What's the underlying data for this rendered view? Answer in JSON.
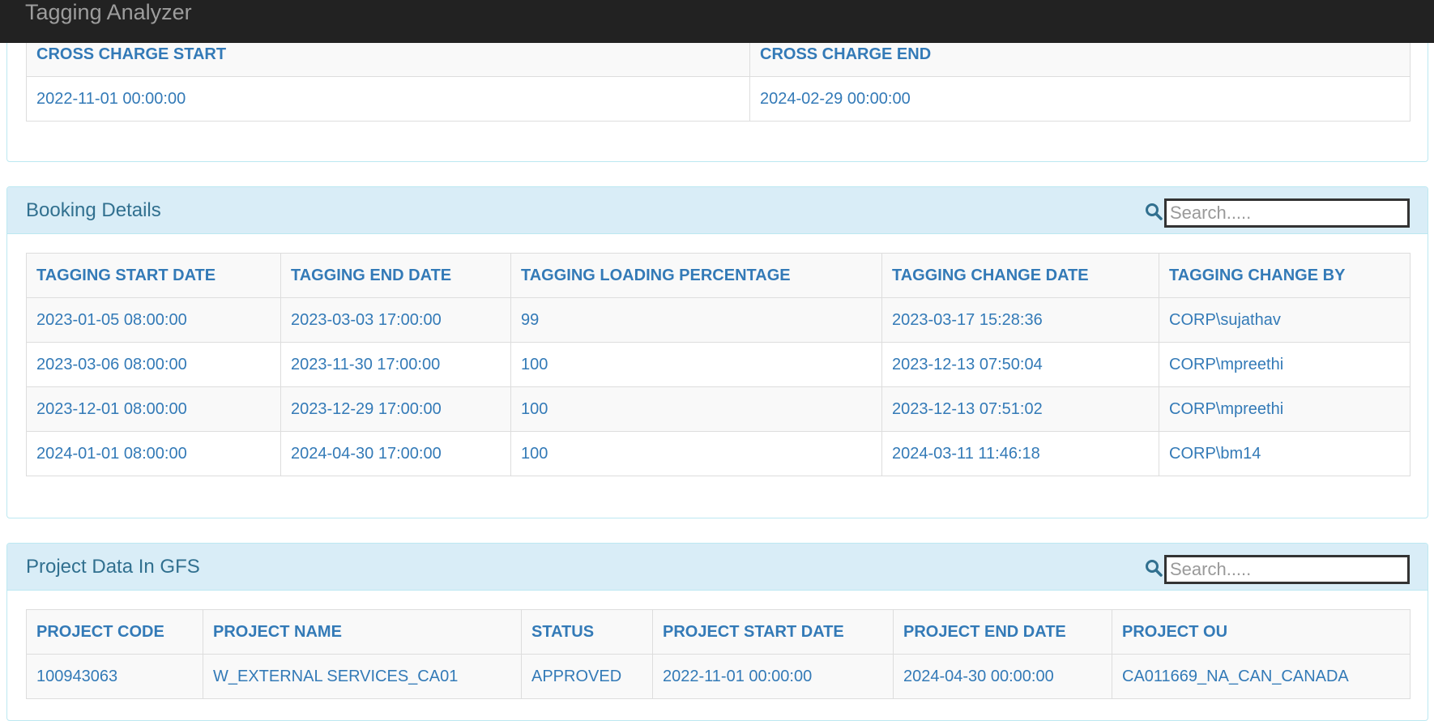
{
  "app": {
    "title": "Tagging Analyzer"
  },
  "cross_charge": {
    "headers": [
      "CROSS CHARGE START",
      "CROSS CHARGE END"
    ],
    "row": [
      "2022-11-01 00:00:00",
      "2024-02-29 00:00:00"
    ]
  },
  "booking": {
    "title": "Booking Details",
    "search_placeholder": "Search.....",
    "headers": [
      "TAGGING START DATE",
      "TAGGING END DATE",
      "TAGGING LOADING PERCENTAGE",
      "TAGGING CHANGE DATE",
      "TAGGING CHANGE BY"
    ],
    "rows": [
      [
        "2023-01-05 08:00:00",
        "2023-03-03 17:00:00",
        "99",
        "2023-03-17 15:28:36",
        "CORP\\sujathav"
      ],
      [
        "2023-03-06 08:00:00",
        "2023-11-30 17:00:00",
        "100",
        "2023-12-13 07:50:04",
        "CORP\\mpreethi"
      ],
      [
        "2023-12-01 08:00:00",
        "2023-12-29 17:00:00",
        "100",
        "2023-12-13 07:51:02",
        "CORP\\mpreethi"
      ],
      [
        "2024-01-01 08:00:00",
        "2024-04-30 17:00:00",
        "100",
        "2024-03-11 11:46:18",
        "CORP\\bm14"
      ]
    ]
  },
  "project": {
    "title": "Project Data In GFS",
    "search_placeholder": "Search.....",
    "headers": [
      "PROJECT CODE",
      "PROJECT NAME",
      "STATUS",
      "PROJECT START DATE",
      "PROJECT END DATE",
      "PROJECT OU"
    ],
    "rows": [
      [
        "100943063",
        "W_EXTERNAL SERVICES_CA01",
        "APPROVED",
        "2022-11-01 00:00:00",
        "2024-04-30 00:00:00",
        "CA011669_NA_CAN_CANADA"
      ]
    ]
  },
  "colors": {
    "topbar": "#222222",
    "heading_bg": "#d9edf7",
    "text": "#337ab7",
    "title": "#31708f"
  },
  "icons": {
    "search": "search-icon"
  }
}
